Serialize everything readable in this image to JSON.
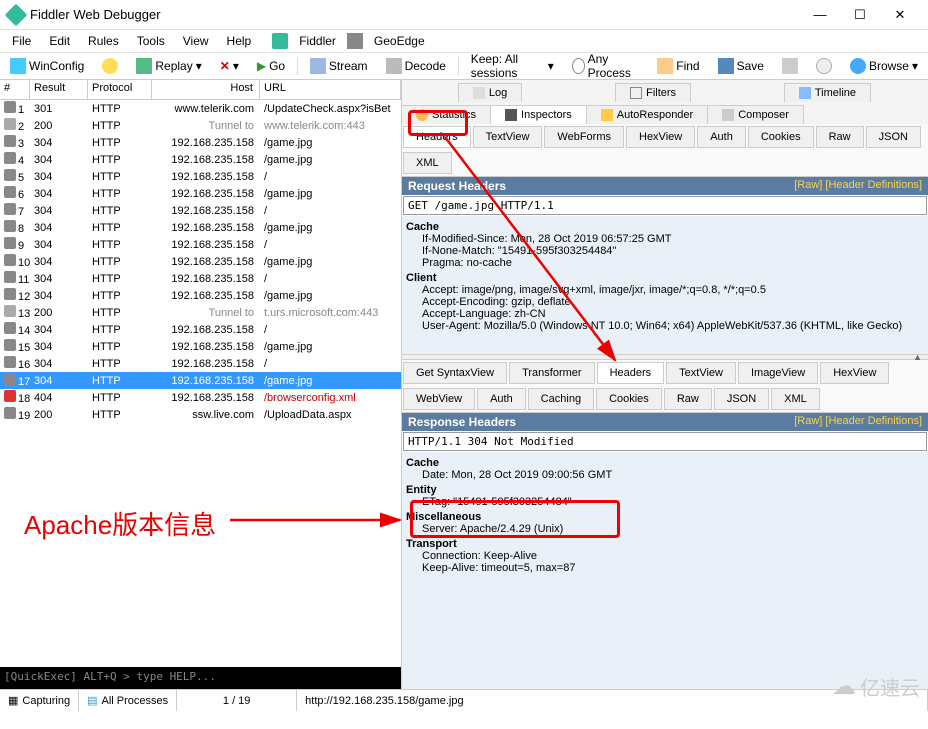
{
  "title": "Fiddler Web Debugger",
  "menubar": [
    "File",
    "Edit",
    "Rules",
    "Tools",
    "View",
    "Help"
  ],
  "menubar_extra": [
    "Fiddler",
    "GeoEdge"
  ],
  "toolbar": {
    "winconfig": "WinConfig",
    "replay": "Replay",
    "go": "Go",
    "stream": "Stream",
    "decode": "Decode",
    "keep": "Keep: All sessions",
    "anyproc": "Any Process",
    "find": "Find",
    "save": "Save",
    "browse": "Browse"
  },
  "grid": {
    "headers": {
      "id": "#",
      "result": "Result",
      "protocol": "Protocol",
      "host": "Host",
      "url": "URL"
    },
    "rows": [
      {
        "id": "1",
        "result": "301",
        "proto": "HTTP",
        "host": "www.telerik.com",
        "url": "/UpdateCheck.aspx?isBet"
      },
      {
        "id": "2",
        "result": "200",
        "proto": "HTTP",
        "host": "Tunnel to",
        "url": "www.telerik.com:443",
        "grey": true
      },
      {
        "id": "3",
        "result": "304",
        "proto": "HTTP",
        "host": "192.168.235.158",
        "url": "/game.jpg"
      },
      {
        "id": "4",
        "result": "304",
        "proto": "HTTP",
        "host": "192.168.235.158",
        "url": "/game.jpg"
      },
      {
        "id": "5",
        "result": "304",
        "proto": "HTTP",
        "host": "192.168.235.158",
        "url": "/"
      },
      {
        "id": "6",
        "result": "304",
        "proto": "HTTP",
        "host": "192.168.235.158",
        "url": "/game.jpg"
      },
      {
        "id": "7",
        "result": "304",
        "proto": "HTTP",
        "host": "192.168.235.158",
        "url": "/"
      },
      {
        "id": "8",
        "result": "304",
        "proto": "HTTP",
        "host": "192.168.235.158",
        "url": "/game.jpg"
      },
      {
        "id": "9",
        "result": "304",
        "proto": "HTTP",
        "host": "192.168.235.158",
        "url": "/"
      },
      {
        "id": "10",
        "result": "304",
        "proto": "HTTP",
        "host": "192.168.235.158",
        "url": "/game.jpg"
      },
      {
        "id": "11",
        "result": "304",
        "proto": "HTTP",
        "host": "192.168.235.158",
        "url": "/"
      },
      {
        "id": "12",
        "result": "304",
        "proto": "HTTP",
        "host": "192.168.235.158",
        "url": "/game.jpg"
      },
      {
        "id": "13",
        "result": "200",
        "proto": "HTTP",
        "host": "Tunnel to",
        "url": "t.urs.microsoft.com:443",
        "grey": true
      },
      {
        "id": "14",
        "result": "304",
        "proto": "HTTP",
        "host": "192.168.235.158",
        "url": "/"
      },
      {
        "id": "15",
        "result": "304",
        "proto": "HTTP",
        "host": "192.168.235.158",
        "url": "/game.jpg"
      },
      {
        "id": "16",
        "result": "304",
        "proto": "HTTP",
        "host": "192.168.235.158",
        "url": "/"
      },
      {
        "id": "17",
        "result": "304",
        "proto": "HTTP",
        "host": "192.168.235.158",
        "url": "/game.jpg",
        "sel": true
      },
      {
        "id": "18",
        "result": "404",
        "proto": "HTTP",
        "host": "192.168.235.158",
        "url": "/browserconfig.xml",
        "red": true
      },
      {
        "id": "19",
        "result": "200",
        "proto": "HTTP",
        "host": "ssw.live.com",
        "url": "/UploadData.aspx"
      }
    ]
  },
  "quickexec": "[QuickExec] ALT+Q > type HELP...",
  "right_top_tabs": [
    "Log",
    "Filters",
    "Timeline"
  ],
  "right_mid_tabs": [
    "Statistics",
    "Inspectors",
    "AutoResponder",
    "Composer"
  ],
  "req_tabs": [
    "Headers",
    "TextView",
    "WebForms",
    "HexView",
    "Auth",
    "Cookies",
    "Raw",
    "JSON",
    "XML"
  ],
  "req_title": "Request Headers",
  "req_links": "[Raw]   [Header Definitions]",
  "req_line": "GET /game.jpg HTTP/1.1",
  "req_sections": {
    "cache_t": "Cache",
    "cache": [
      "If-Modified-Since: Mon, 28 Oct 2019 06:57:25 GMT",
      "If-None-Match: \"15491-595f303254484\"",
      "Pragma: no-cache"
    ],
    "client_t": "Client",
    "client": [
      "Accept: image/png, image/svg+xml, image/jxr, image/*;q=0.8, */*;q=0.5",
      "Accept-Encoding: gzip, deflate",
      "Accept-Language: zh-CN",
      "User-Agent: Mozilla/5.0 (Windows NT 10.0; Win64; x64) AppleWebKit/537.36 (KHTML, like Gecko)"
    ]
  },
  "resp_tabs1": [
    "Get SyntaxView",
    "Transformer",
    "Headers",
    "TextView",
    "ImageView",
    "HexView",
    "WebView"
  ],
  "resp_tabs2": [
    "Auth",
    "Caching",
    "Cookies",
    "Raw",
    "JSON",
    "XML"
  ],
  "resp_title": "Response Headers",
  "resp_links": "[Raw]   [Header Definitions]",
  "resp_line": "HTTP/1.1 304 Not Modified",
  "resp_sections": {
    "cache_t": "Cache",
    "cache": [
      "Date: Mon, 28 Oct 2019 09:00:56 GMT"
    ],
    "entity_t": "Entity",
    "entity": [
      "ETag: \"15491-595f303254484\""
    ],
    "misc_t": "Miscellaneous",
    "misc": [
      "Server: Apache/2.4.29 (Unix)"
    ],
    "trans_t": "Transport",
    "trans": [
      "Connection: Keep-Alive",
      "Keep-Alive: timeout=5, max=87"
    ]
  },
  "status": {
    "capturing": "Capturing",
    "processes": "All Processes",
    "count": "1 / 19",
    "url": "http://192.168.235.158/game.jpg"
  },
  "annotation": "Apache版本信息",
  "watermark": "亿速云"
}
